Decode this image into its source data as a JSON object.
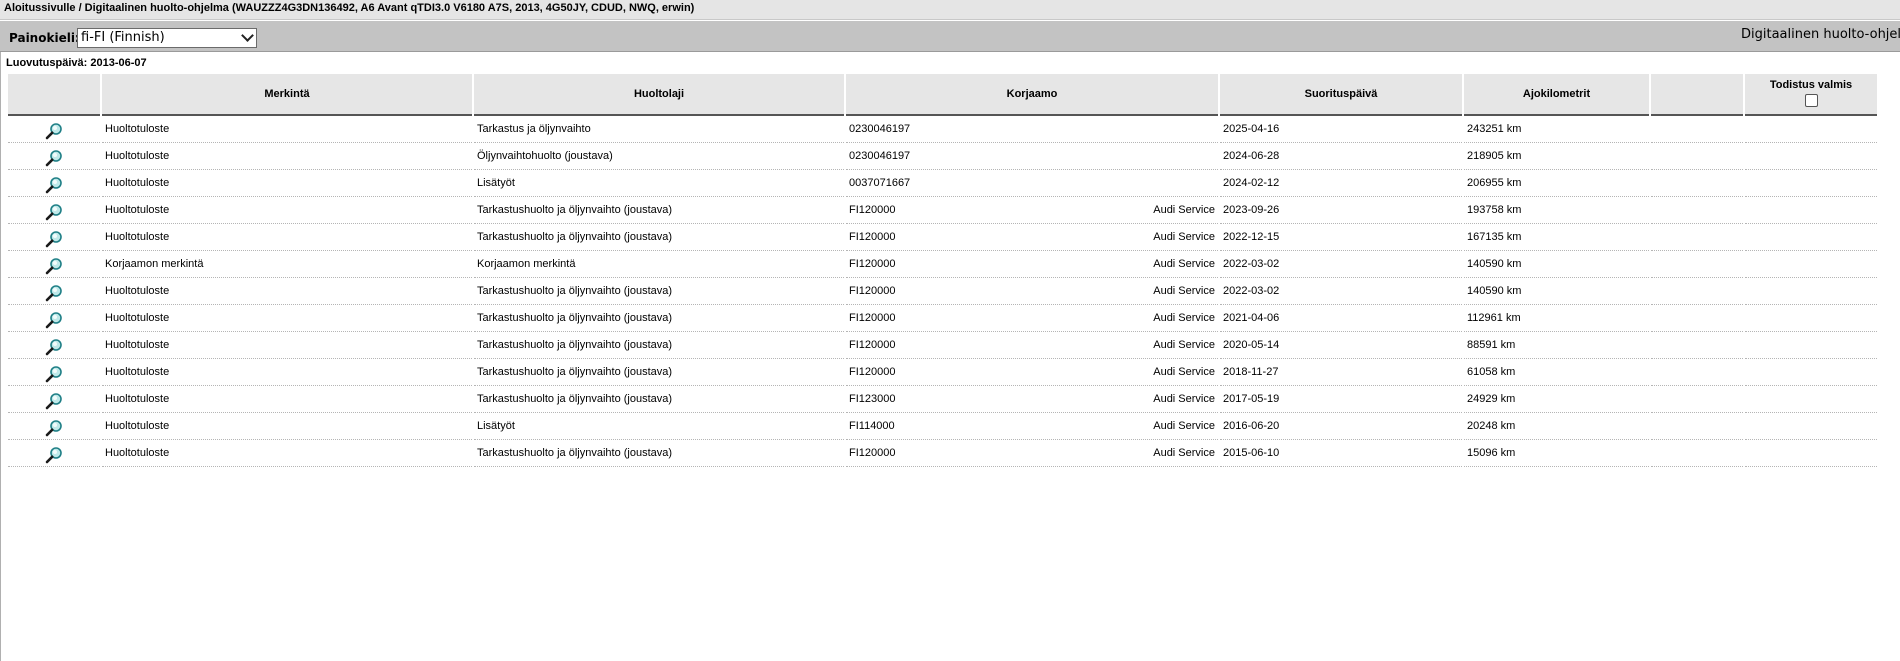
{
  "title_bar": {
    "text": "Aloitussivulle / Digitaalinen huolto-ohjelma (WAUZZZ4G3DN136492, A6 Avant qTDI3.0 V6180 A7S, 2013, 4G50JY, CDUD, NWQ, erwin)"
  },
  "toolbar": {
    "language_label": "Painokieli:",
    "language_value": "fi-FI (Finnish)",
    "right_title": "Digitaalinen huolto-ohjelma"
  },
  "delivery_date": "Luovutuspäivä: 2013-06-07",
  "table": {
    "headers": {
      "merkinta": "Merkintä",
      "huoltolaji": "Huoltolaji",
      "korjaamo": "Korjaamo",
      "suorituspaiva": "Suorituspäivä",
      "ajokilometrit": "Ajokilometrit",
      "empty": "",
      "todistus": "Todistus valmis"
    },
    "rows": [
      {
        "merkinta": "Huoltotuloste",
        "huoltolaji": "Tarkastus ja öljynvaihto",
        "korjaamo_code": "0230046197",
        "korjaamo_name": "",
        "date": "2025-04-16",
        "km": "243251 km"
      },
      {
        "merkinta": "Huoltotuloste",
        "huoltolaji": "Öljynvaihtohuolto (joustava)",
        "korjaamo_code": "0230046197",
        "korjaamo_name": "",
        "date": "2024-06-28",
        "km": "218905 km"
      },
      {
        "merkinta": "Huoltotuloste",
        "huoltolaji": "Lisätyöt",
        "korjaamo_code": "0037071667",
        "korjaamo_name": "",
        "date": "2024-02-12",
        "km": "206955 km"
      },
      {
        "merkinta": "Huoltotuloste",
        "huoltolaji": "Tarkastushuolto ja öljynvaihto (joustava)",
        "korjaamo_code": "FI120000",
        "korjaamo_name": "Audi Service",
        "date": "2023-09-26",
        "km": "193758 km"
      },
      {
        "merkinta": "Huoltotuloste",
        "huoltolaji": "Tarkastushuolto ja öljynvaihto (joustava)",
        "korjaamo_code": "FI120000",
        "korjaamo_name": "Audi Service",
        "date": "2022-12-15",
        "km": "167135 km"
      },
      {
        "merkinta": "Korjaamon merkintä",
        "huoltolaji": "Korjaamon merkintä",
        "korjaamo_code": "FI120000",
        "korjaamo_name": "Audi Service",
        "date": "2022-03-02",
        "km": "140590 km"
      },
      {
        "merkinta": "Huoltotuloste",
        "huoltolaji": "Tarkastushuolto ja öljynvaihto (joustava)",
        "korjaamo_code": "FI120000",
        "korjaamo_name": "Audi Service",
        "date": "2022-03-02",
        "km": "140590 km"
      },
      {
        "merkinta": "Huoltotuloste",
        "huoltolaji": "Tarkastushuolto ja öljynvaihto (joustava)",
        "korjaamo_code": "FI120000",
        "korjaamo_name": "Audi Service",
        "date": "2021-04-06",
        "km": "112961 km"
      },
      {
        "merkinta": "Huoltotuloste",
        "huoltolaji": "Tarkastushuolto ja öljynvaihto (joustava)",
        "korjaamo_code": "FI120000",
        "korjaamo_name": "Audi Service",
        "date": "2020-05-14",
        "km": "88591 km"
      },
      {
        "merkinta": "Huoltotuloste",
        "huoltolaji": "Tarkastushuolto ja öljynvaihto (joustava)",
        "korjaamo_code": "FI120000",
        "korjaamo_name": "Audi Service",
        "date": "2018-11-27",
        "km": "61058 km"
      },
      {
        "merkinta": "Huoltotuloste",
        "huoltolaji": "Tarkastushuolto ja öljynvaihto (joustava)",
        "korjaamo_code": "FI123000",
        "korjaamo_name": "Audi Service",
        "date": "2017-05-19",
        "km": "24929 km"
      },
      {
        "merkinta": "Huoltotuloste",
        "huoltolaji": "Lisätyöt",
        "korjaamo_code": "FI114000",
        "korjaamo_name": "Audi Service",
        "date": "2016-06-20",
        "km": "20248 km"
      },
      {
        "merkinta": "Huoltotuloste",
        "huoltolaji": "Tarkastushuolto ja öljynvaihto (joustava)",
        "korjaamo_code": "FI120000",
        "korjaamo_name": "Audi Service",
        "date": "2015-06-10",
        "km": "15096 km"
      }
    ]
  },
  "icons": {
    "row_view": "magnifier-icon",
    "select_caret": "chevron-down-icon"
  },
  "colors": {
    "title_bg": "#e5e5e5",
    "toolbar_bg": "#c3c3c3",
    "header_bg": "#e6e6e6",
    "magnifier_lens": "#2fa3a3"
  }
}
